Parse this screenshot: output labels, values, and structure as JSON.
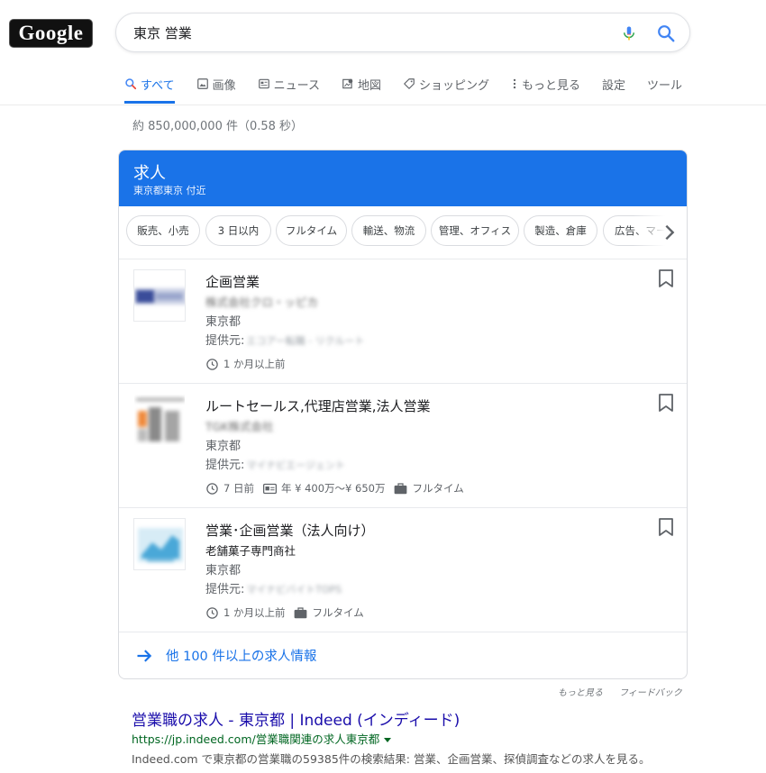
{
  "header": {
    "logo_text": "Google",
    "search_query": "東京 営業"
  },
  "tabs": [
    {
      "label": "すべて",
      "icon": "search-icon",
      "active": true
    },
    {
      "label": "画像",
      "icon": "image-icon"
    },
    {
      "label": "ニュース",
      "icon": "news-icon"
    },
    {
      "label": "地図",
      "icon": "map-icon"
    },
    {
      "label": "ショッピング",
      "icon": "tag-icon"
    },
    {
      "label": "もっと見る",
      "icon": "more-vert-icon"
    },
    {
      "label": "設定"
    },
    {
      "label": "ツール"
    }
  ],
  "result_stats": "約 850,000,000 件（0.58 秒）",
  "jobs": {
    "title": "求人",
    "subtitle": "東京都東京 付近",
    "chips": [
      "販売、小売",
      "3 日以内",
      "フルタイム",
      "輸送、物流",
      "管理、オフィス",
      "製造、倉庫",
      "広告、マーケ"
    ],
    "listings": [
      {
        "title": "企画営業",
        "company": "株式会社クロ・ッピカ",
        "location": "東京都",
        "via_label": "提供元:",
        "via_name": "エコアー転職 - リクルート",
        "posted": "1 か月以上前",
        "salary": "",
        "type": ""
      },
      {
        "title": "ルートセールス,代理店営業,法人営業",
        "company": "TGK株式会社",
        "location": "東京都",
        "via_label": "提供元:",
        "via_name": "マイナビエージェント",
        "posted": "7 日前",
        "salary": "年 ¥ 400万～¥ 650万",
        "type": "フルタイム"
      },
      {
        "title": "営業･企画営業（法人向け）",
        "company": "老舗菓子専門商社",
        "location": "東京都",
        "via_label": "提供元:",
        "via_name": "マイナビバイトTOPS",
        "posted": "1 か月以上前",
        "salary": "",
        "type": "フルタイム"
      }
    ],
    "more_label": "他 100 件以上の求人情報"
  },
  "feedback": {
    "more": "もっと見る",
    "feedback": "フィードバック"
  },
  "result": {
    "title": "営業職の求人 - 東京都 | Indeed (インディード)",
    "url": "https://jp.indeed.com/営業職関連の求人東京都",
    "snippet": "Indeed.com で東京都の営業職の59385件の検索結果: 営業、企画営業、探偵調査などの求人を見る。"
  },
  "colors": {
    "accent": "#1a73e8",
    "link": "#1a0dab",
    "url_green": "#006621"
  }
}
